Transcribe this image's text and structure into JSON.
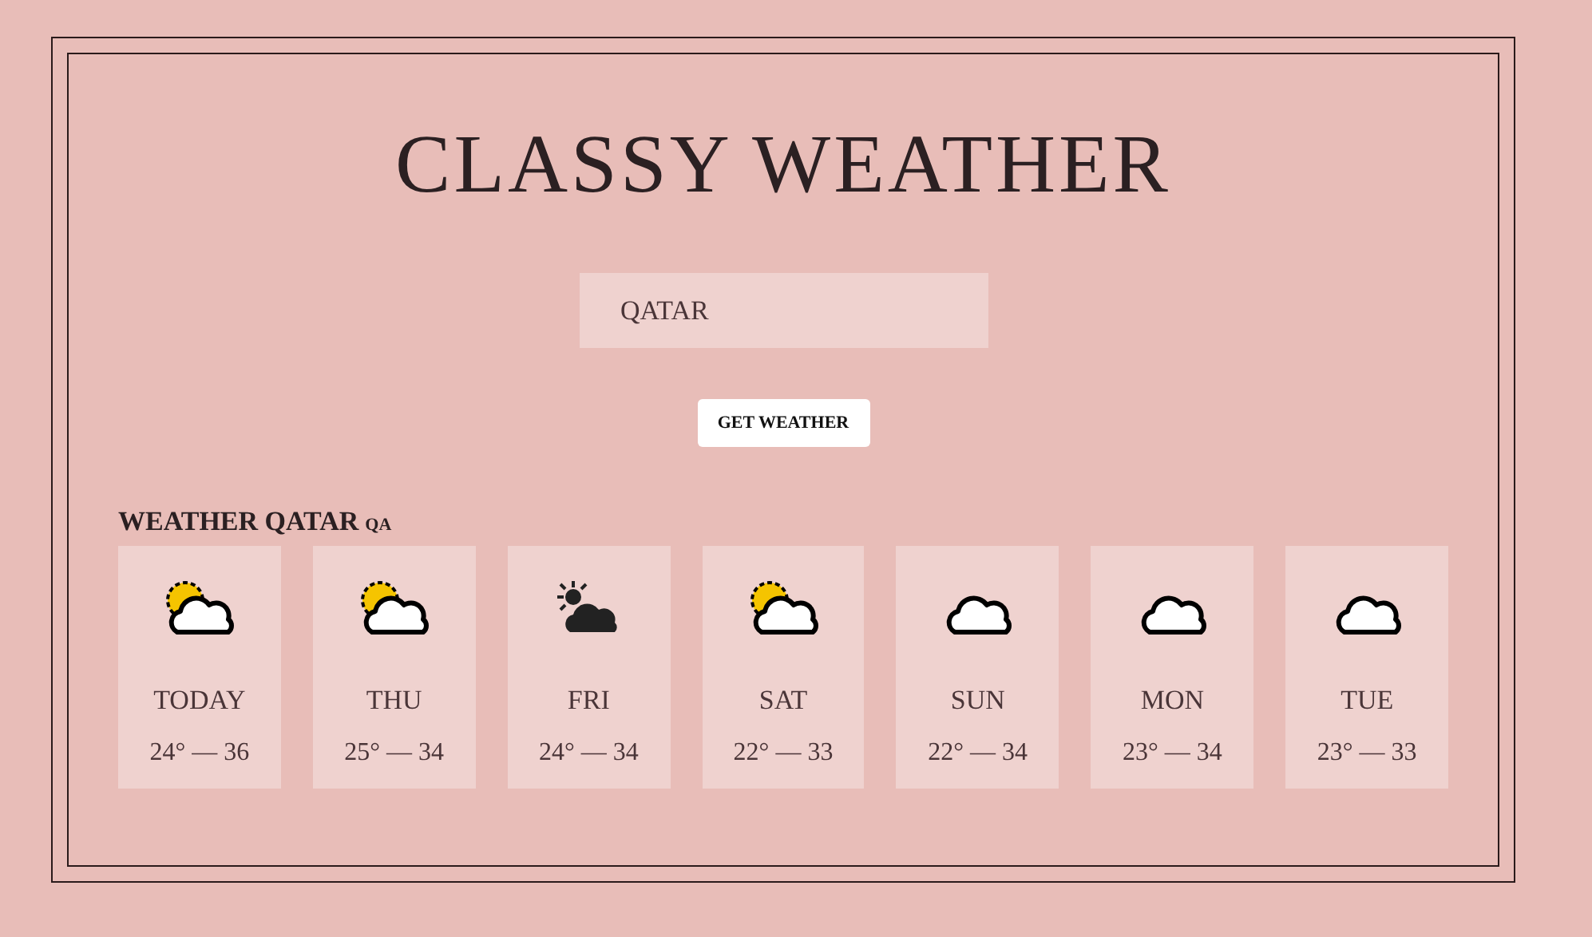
{
  "title": "CLASSY WEATHER",
  "search": {
    "value": "QATAR"
  },
  "button": "GET WEATHER",
  "forecast": {
    "heading": "WEATHER QATAR",
    "country_code": "QA",
    "days": [
      {
        "kind": "suncloud",
        "day": "TODAY",
        "range": "24° — 36"
      },
      {
        "kind": "suncloud",
        "day": "THU",
        "range": "25° — 34"
      },
      {
        "kind": "darkcloud",
        "day": "FRI",
        "range": "24° — 34"
      },
      {
        "kind": "suncloud",
        "day": "SAT",
        "range": "22° — 33"
      },
      {
        "kind": "cloud",
        "day": "SUN",
        "range": "22° — 34"
      },
      {
        "kind": "cloud",
        "day": "MON",
        "range": "23° — 34"
      },
      {
        "kind": "cloud",
        "day": "TUE",
        "range": "23° — 33"
      }
    ]
  }
}
